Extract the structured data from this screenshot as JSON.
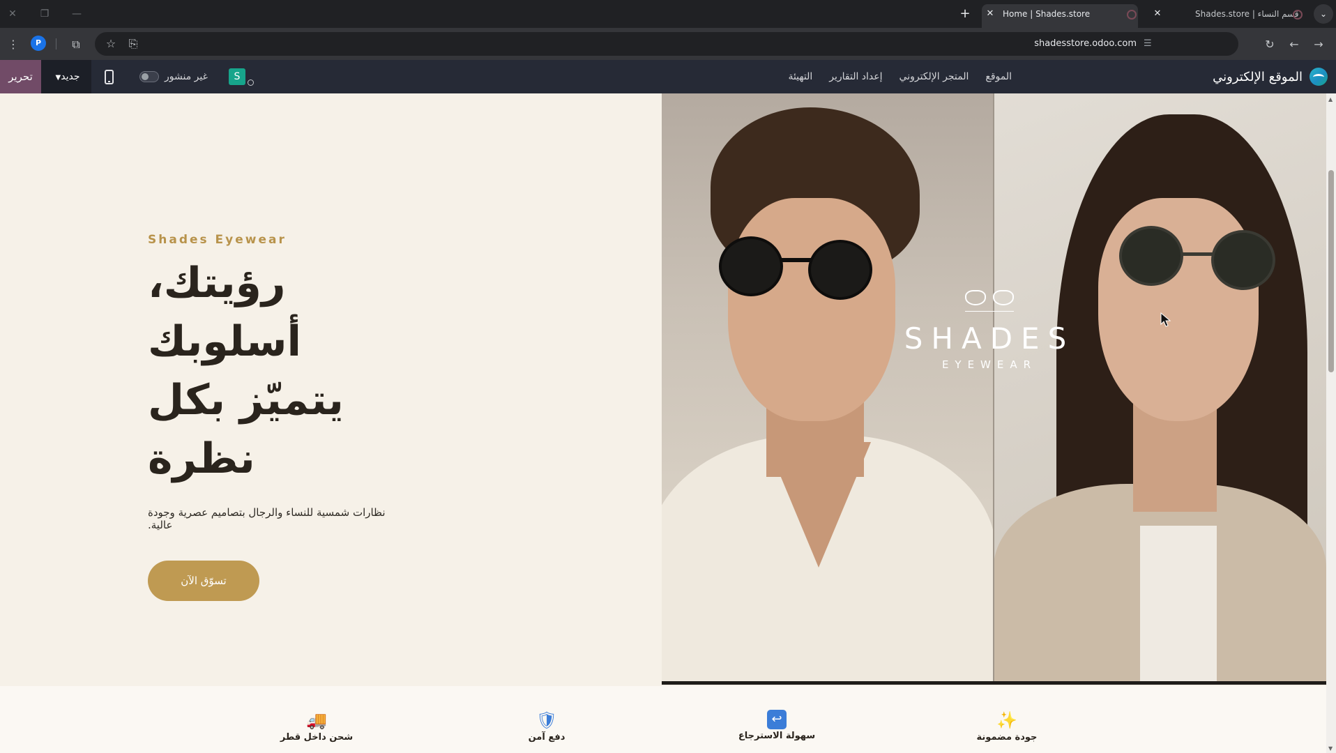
{
  "browser": {
    "tabs": [
      {
        "title": "Home | Shades.store",
        "active": true
      },
      {
        "title": "قسم النساء | Shades.store",
        "active": false
      }
    ],
    "url": "shadesstore.odoo.com"
  },
  "admin_bar": {
    "brand": "الموقع الإلكتروني",
    "menu": [
      "الموقع",
      "المتجر الإلكتروني",
      "إعداد التقارير",
      "التهيئة"
    ],
    "edit_label": "تحرير",
    "new_label": "جديد",
    "publish_label": "غير منشور",
    "site_initial": "S",
    "colors": {
      "edit_bg": "#714b67",
      "bar_bg": "#262a36"
    }
  },
  "hero": {
    "eyebrow": "Shades Eyewear",
    "headline_line1": "رؤيتك، أسلوبك",
    "headline_line2": "يتميّز بكل نظرة",
    "subheading": "نظارات شمسية للنساء والرجال بتصاميم عصرية وجودة عالية.",
    "cta_label": "تسوّق الآن",
    "colors": {
      "background": "#f6f1e8",
      "accent": "#bf9a52",
      "eyebrow": "#b8934b"
    }
  },
  "logo": {
    "title": "SHADES",
    "subtitle": "EYEWEAR"
  },
  "features": [
    {
      "icon": "delivery-truck-icon",
      "glyph": "🚚",
      "label": "شحن داخل قطر"
    },
    {
      "icon": "shield-icon",
      "glyph": "🛡",
      "label": "دفع آمن"
    },
    {
      "icon": "return-arrow-icon",
      "glyph": "↩",
      "label": "سهولة الاسترجاع"
    },
    {
      "icon": "sparkles-icon",
      "glyph": "✨",
      "label": "جودة مضمونة"
    }
  ]
}
